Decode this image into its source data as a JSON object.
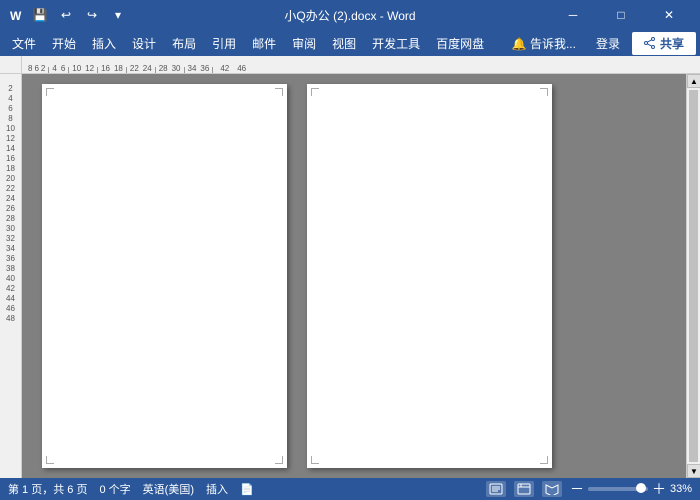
{
  "titlebar": {
    "title": "小Q办公 (2).docx - Word",
    "save_icon": "💾",
    "undo_icon": "↩",
    "redo_icon": "↪",
    "dropdown_icon": "▾",
    "minimize_icon": "─",
    "restore_icon": "□",
    "close_icon": "✕"
  },
  "menubar": {
    "items": [
      "文件",
      "开始",
      "插入",
      "设计",
      "布局",
      "引用",
      "邮件",
      "审阅",
      "视图",
      "开发工具",
      "百度网盘"
    ],
    "right_items": [
      "🔔 告诉我...",
      "登录"
    ],
    "share_label": "共享"
  },
  "ruler": {
    "h_marks": [
      "8",
      "6",
      "2",
      "4",
      "6",
      "10",
      "12",
      "16",
      "18",
      "22",
      "24",
      "28",
      "30",
      "34",
      "36",
      "42",
      "46"
    ],
    "v_marks": [
      "2",
      "4",
      "6",
      "8",
      "10",
      "12",
      "14",
      "16",
      "18",
      "20",
      "22",
      "24",
      "26",
      "28",
      "30",
      "32",
      "34",
      "36",
      "38",
      "40",
      "42",
      "44",
      "46",
      "48"
    ]
  },
  "statusbar": {
    "page_info": "第 1 页，共 6 页",
    "word_count": "0 个字",
    "language": "英语(美国)",
    "insert_mode": "插入",
    "revision_icon": "📄",
    "zoom_percent": "33%",
    "zoom_minus": "－",
    "zoom_plus": "＋"
  }
}
